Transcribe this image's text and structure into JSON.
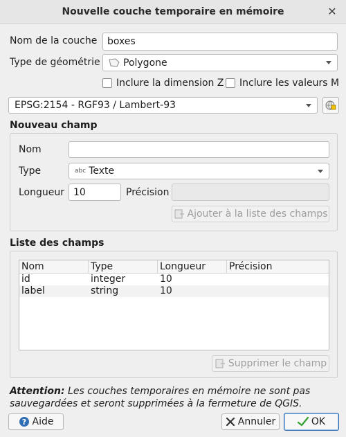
{
  "window": {
    "title": "Nouvelle couche temporaire en mémoire"
  },
  "layer": {
    "name_label": "Nom de la couche",
    "name_value": "boxes",
    "geometry_label": "Type de géométrie",
    "geometry_value": "Polygone",
    "include_z_label": "Inclure la dimension Z",
    "include_m_label": "Inclure les valeurs M",
    "crs_value": "EPSG:2154 - RGF93 / Lambert-93"
  },
  "new_field": {
    "section_title": "Nouveau champ",
    "name_label": "Nom",
    "name_value": "",
    "type_label": "Type",
    "type_icon_text": "abc",
    "type_value": "Texte",
    "length_label": "Longueur",
    "length_value": "10",
    "precision_label": "Précision",
    "precision_value": "",
    "add_button_label": "Ajouter à la liste des champs"
  },
  "field_list": {
    "section_title": "Liste des champs",
    "columns": [
      "Nom",
      "Type",
      "Longueur",
      "Précision"
    ],
    "rows": [
      {
        "name": "id",
        "type": "integer",
        "length": "10",
        "precision": ""
      },
      {
        "name": "label",
        "type": "string",
        "length": "10",
        "precision": ""
      }
    ],
    "delete_button_label": "Supprimer le champ"
  },
  "warning": {
    "strong": "Attention:",
    "text": " Les couches temporaires en mémoire ne sont pas sauvegardées et seront supprimées à la fermeture de QGIS."
  },
  "buttons": {
    "help_label": "Aide",
    "cancel_label": "Annuler",
    "ok_label": "OK"
  },
  "icons": {
    "close": "close-icon",
    "polygon": "polygon-icon",
    "crs_select": "crs-globe-icon",
    "add_field": "add-field-icon",
    "delete_field": "delete-field-icon",
    "help": "help-icon",
    "cancel": "cancel-x-icon",
    "ok": "ok-check-icon"
  },
  "colors": {
    "accent": "#2f6db4",
    "ok_green": "#3aa336",
    "cancel_red": "#333333"
  }
}
